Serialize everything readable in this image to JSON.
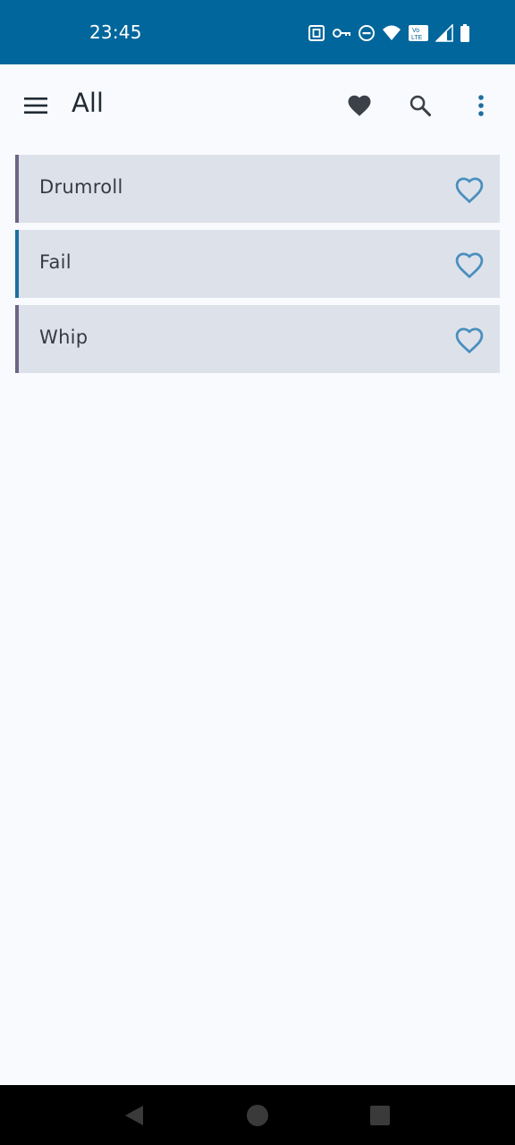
{
  "status_bar": {
    "time": "23:45",
    "icons": [
      "nfc-icon",
      "vpn-key-icon",
      "do-not-disturb-icon",
      "wifi-icon",
      "volte-icon",
      "signal-icon",
      "battery-icon"
    ],
    "volte_text_top": "Vo",
    "volte_text_bottom": "LTE"
  },
  "app_bar": {
    "title": "All",
    "icons": [
      "menu-icon",
      "favorites-filter-icon",
      "search-icon",
      "more-vert-icon"
    ]
  },
  "items": [
    {
      "label": "Drumroll",
      "favorite": false,
      "accent": "#6d6585"
    },
    {
      "label": "Fail",
      "favorite": false,
      "accent": "#1f6f9e"
    },
    {
      "label": "Whip",
      "favorite": false,
      "accent": "#6d6585"
    }
  ],
  "nav_bar": {
    "icons": [
      "back-icon",
      "home-icon",
      "recents-icon"
    ]
  },
  "colors": {
    "status_bar": "#00669b",
    "background": "#f9fafd",
    "item_background": "#dde2ea",
    "heart_outline": "#4a8fbe",
    "toolbar_icon": "#3b4148",
    "overflow_icon": "#1f6f9e"
  }
}
